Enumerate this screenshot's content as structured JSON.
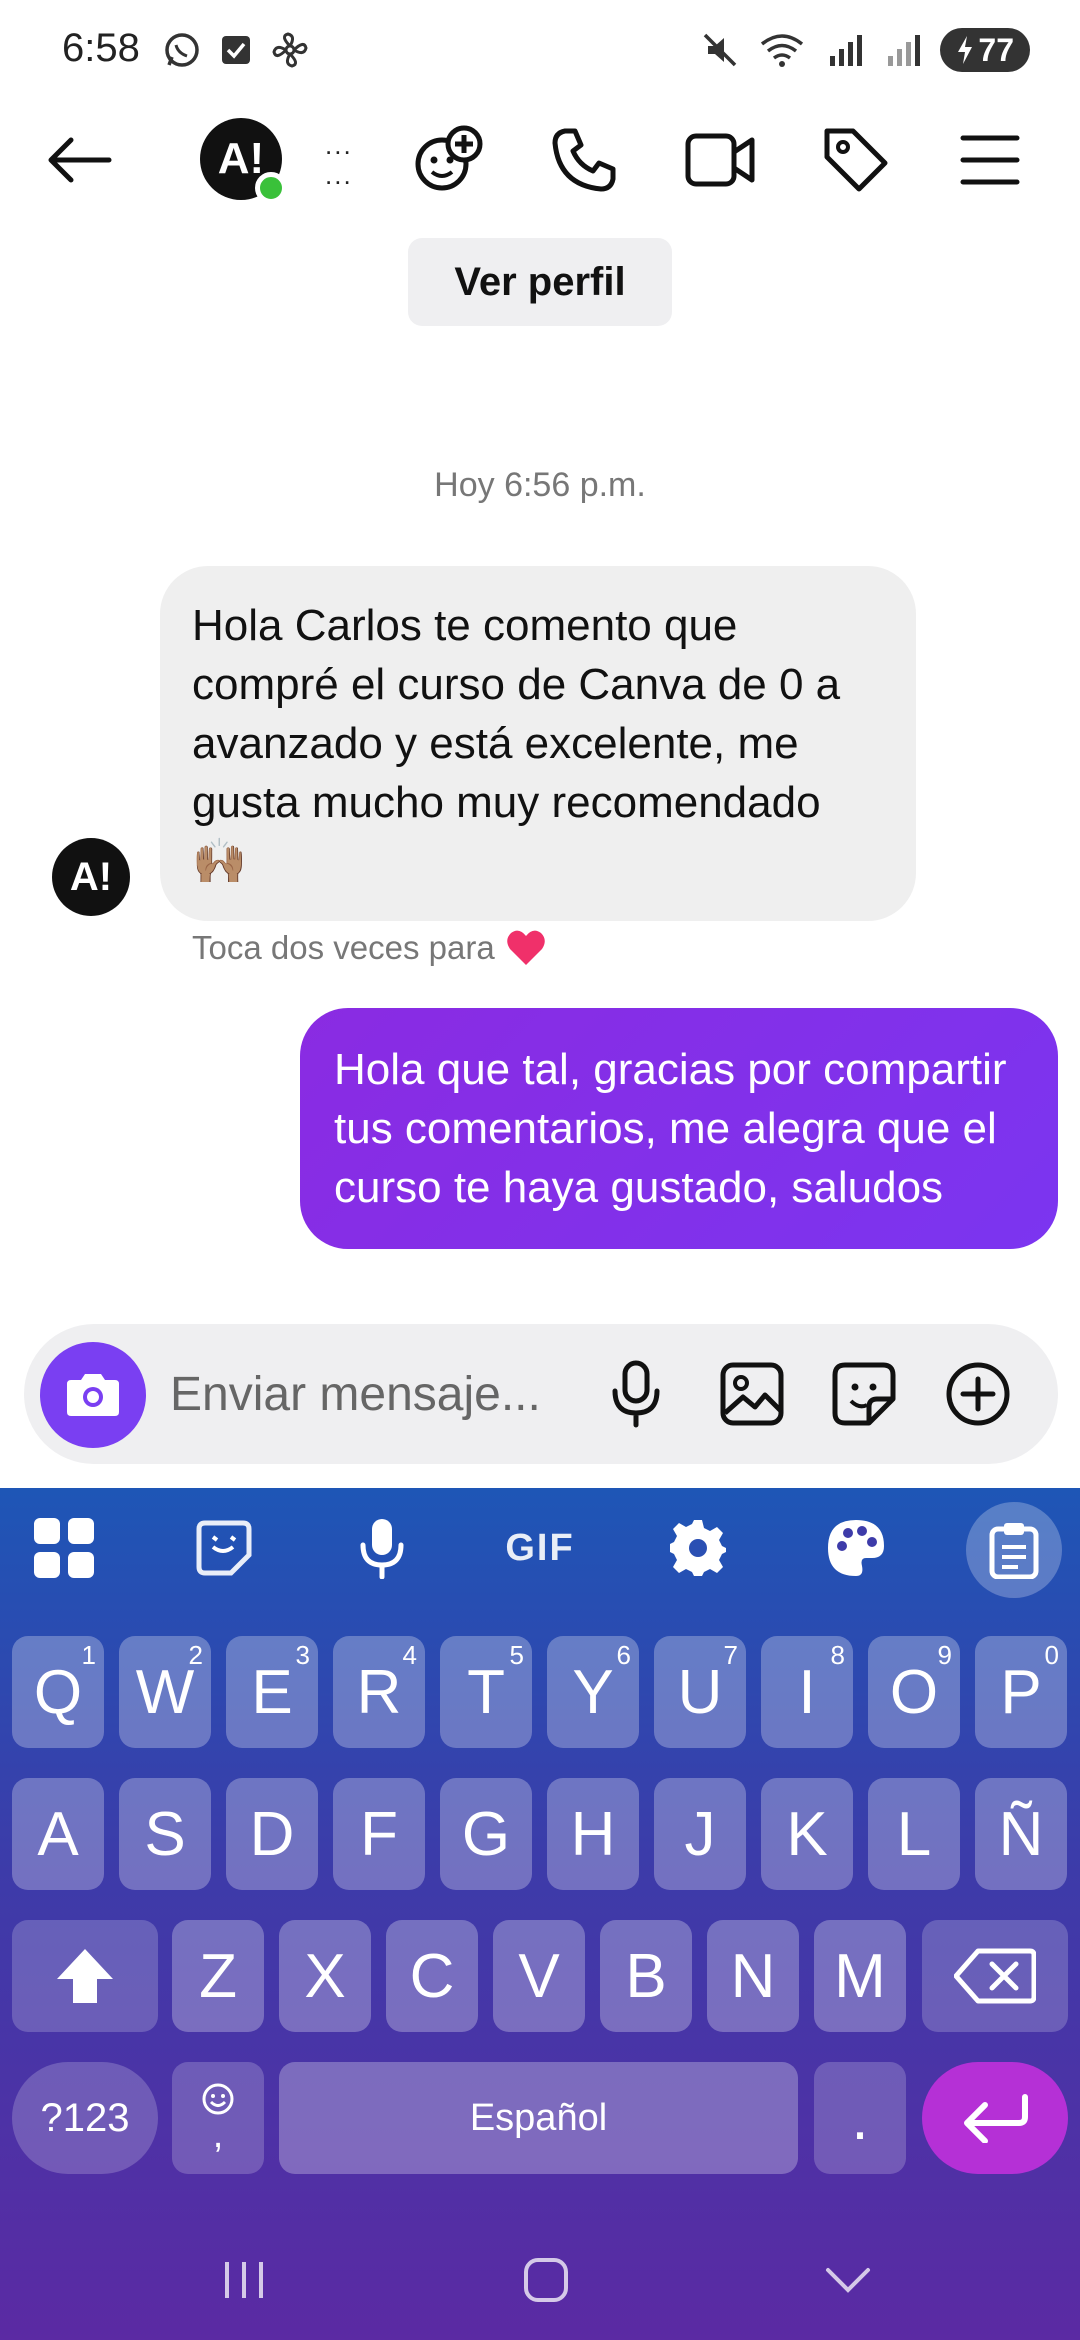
{
  "status_bar": {
    "time": "6:58",
    "battery": "77"
  },
  "header": {
    "contact_name": "...",
    "contact_subtitle": "...",
    "avatar_text": "A!"
  },
  "view_profile_label": "Ver perfil",
  "chat": {
    "timestamp": "Hoy 6:56 p.m.",
    "incoming_message": "Hola Carlos te comento que compré el curso de Canva de 0 a avanzado y está excelente, me gusta mucho muy recomendado 🙌🏽",
    "double_tap_hint": "Toca dos veces para",
    "outgoing_message": "Hola que tal, gracias por compartir tus comentarios, me alegra que el curso te haya gustado, saludos"
  },
  "composer": {
    "placeholder": "Enviar mensaje..."
  },
  "keyboard": {
    "gif_label": "GIF",
    "row1": [
      {
        "key": "Q",
        "num": "1"
      },
      {
        "key": "W",
        "num": "2"
      },
      {
        "key": "E",
        "num": "3"
      },
      {
        "key": "R",
        "num": "4"
      },
      {
        "key": "T",
        "num": "5"
      },
      {
        "key": "Y",
        "num": "6"
      },
      {
        "key": "U",
        "num": "7"
      },
      {
        "key": "I",
        "num": "8"
      },
      {
        "key": "O",
        "num": "9"
      },
      {
        "key": "P",
        "num": "0"
      }
    ],
    "row2": [
      "A",
      "S",
      "D",
      "F",
      "G",
      "H",
      "J",
      "K",
      "L",
      "Ñ"
    ],
    "row3": [
      "Z",
      "X",
      "C",
      "V",
      "B",
      "N",
      "M"
    ],
    "symbols_label": "?123",
    "emoji_key_sub": ",",
    "space_label": "Español",
    "period_label": "."
  },
  "colors": {
    "accent": "#7a3ff2",
    "outgoing_bubble": "#8a2be2",
    "online": "#3ac13a"
  }
}
